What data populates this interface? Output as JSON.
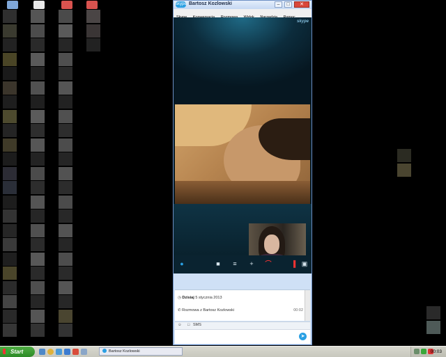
{
  "window": {
    "title": "Bartosz Kozlowski",
    "logo_text": "skype",
    "controls": [
      "–",
      "□",
      "✕"
    ]
  },
  "menu": [
    "Skype",
    "Konwersacja",
    "Rozmowa",
    "Widok",
    "Narzędzia",
    "Pomoc"
  ],
  "video": {
    "watermark": "skype"
  },
  "call_controls": [
    {
      "name": "chat-toggle",
      "icon": "chat-bubble-icon",
      "glyph": "●"
    },
    {
      "name": "video-toggle",
      "icon": "video-camera-icon",
      "glyph": "■"
    },
    {
      "name": "mic-toggle",
      "icon": "microphone-icon",
      "glyph": "≡"
    },
    {
      "name": "add-button",
      "icon": "plus-icon",
      "glyph": "+"
    },
    {
      "name": "hang-up-button",
      "icon": "hang-up-icon",
      "glyph": "⌒"
    },
    {
      "name": "signal-indicator",
      "icon": "signal-bars-icon",
      "glyph": "▐"
    },
    {
      "name": "fullscreen-button",
      "icon": "fullscreen-icon",
      "glyph": "▣"
    }
  ],
  "chat": {
    "date_label": "Dzisiaj",
    "date_value": "5 stycznia 2013",
    "call_entry": "Rozmowa z Bartosz Kozlowski",
    "call_duration": "00:02"
  },
  "input_bar": {
    "sms_label": "SMS"
  },
  "taskbar": {
    "start_label": "Start",
    "task_item": "Bartosz Kozlowski",
    "clock": "00:03"
  },
  "colors": {
    "skype_blue": "#2aa0e3",
    "hang_up_red": "#e33333",
    "start_green": "#3a9a30"
  }
}
